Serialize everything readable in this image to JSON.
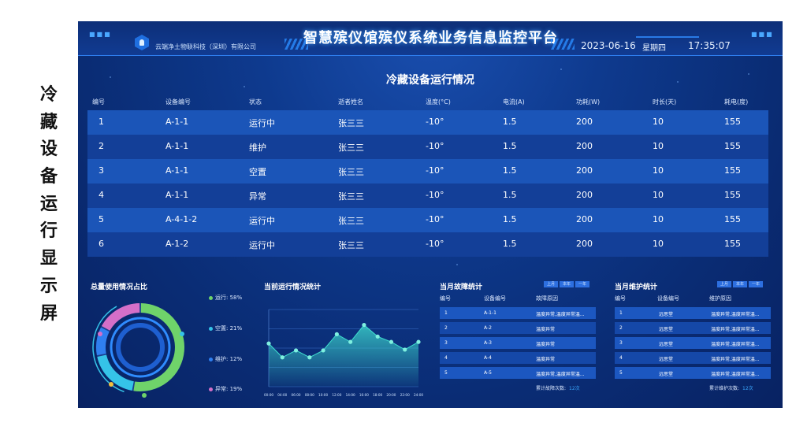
{
  "caption": [
    "冷",
    "藏",
    "设",
    "备",
    "运",
    "行",
    "显",
    "示",
    "屏"
  ],
  "header": {
    "company": "云端净土物联科技（深圳）有限公司",
    "title": "智慧殡仪馆殡仪系统业务信息监控平台",
    "date": "2023-06-16",
    "weekday": "星期四",
    "time": "17:35:07"
  },
  "table": {
    "title": "冷藏设备运行情况",
    "columns": [
      "编号",
      "设备编号",
      "状态",
      "逝者姓名",
      "温度(°C)",
      "电流(A)",
      "功耗(W)",
      "时长(天)",
      "耗电(度)"
    ],
    "rows": [
      [
        "1",
        "A-1-1",
        "运行中",
        "张三三",
        "-10°",
        "1.5",
        "200",
        "10",
        "155"
      ],
      [
        "2",
        "A-1-1",
        "维护",
        "张三三",
        "-10°",
        "1.5",
        "200",
        "10",
        "155"
      ],
      [
        "3",
        "A-1-1",
        "空置",
        "张三三",
        "-10°",
        "1.5",
        "200",
        "10",
        "155"
      ],
      [
        "4",
        "A-1-1",
        "异常",
        "张三三",
        "-10°",
        "1.5",
        "200",
        "10",
        "155"
      ],
      [
        "5",
        "A-4-1-2",
        "运行中",
        "张三三",
        "-10°",
        "1.5",
        "200",
        "10",
        "155"
      ],
      [
        "6",
        "A-1-2",
        "运行中",
        "张三三",
        "-10°",
        "1.5",
        "200",
        "10",
        "155"
      ]
    ]
  },
  "usage": {
    "title": "总量使用情况占比",
    "legend": [
      {
        "label": "运行: 58%",
        "color": "#6fd36a",
        "percent": 58
      },
      {
        "label": "空置: 21%",
        "color": "#35c3e8",
        "percent": 21
      },
      {
        "label": "维护: 12%",
        "color": "#2f7ff0",
        "percent": 12
      },
      {
        "label": "异常: 19%",
        "color": "#d46fc8",
        "percent": 19
      }
    ]
  },
  "running": {
    "title": "当前运行情况统计",
    "chart_data": {
      "type": "area",
      "x": [
        "00:00",
        "04:00",
        "06:00",
        "08:00",
        "10:00",
        "12:00",
        "14:00",
        "16:00",
        "18:00",
        "20:00",
        "22:00",
        "24:00"
      ],
      "series": [
        {
          "values": [
            56,
            38,
            47,
            38,
            47,
            68,
            58,
            80,
            65,
            58,
            48,
            58
          ]
        }
      ],
      "ylim": [
        0,
        100
      ],
      "grid": true,
      "color": "#3fe0d0"
    }
  },
  "faults": {
    "title": "当月故障统计",
    "tabs": [
      "上月",
      "本年",
      "一年"
    ],
    "columns": [
      "编号",
      "设备编号",
      "故障原因"
    ],
    "rows": [
      [
        "1",
        "A-1-1",
        "温度异常,温度异常温..."
      ],
      [
        "2",
        "A-2",
        "温度异常"
      ],
      [
        "3",
        "A-3",
        "温度异常"
      ],
      [
        "4",
        "A-4",
        "温度异常"
      ],
      [
        "5",
        "A-5",
        "温度异常,温度异常温..."
      ]
    ],
    "total_label": "累计故障次数:",
    "total_value": "12次"
  },
  "maintenance": {
    "title": "当月维护统计",
    "tabs": [
      "上月",
      "本年",
      "一年"
    ],
    "columns": [
      "编号",
      "设备编号",
      "维护原因"
    ],
    "rows": [
      [
        "1",
        "远思堂",
        "温度异常,温度异常温..."
      ],
      [
        "2",
        "远思堂",
        "温度异常,温度异常温..."
      ],
      [
        "3",
        "远思堂",
        "温度异常,温度异常温..."
      ],
      [
        "4",
        "远思堂",
        "温度异常,温度异常温..."
      ],
      [
        "5",
        "远思堂",
        "温度异常,温度异常温..."
      ]
    ],
    "total_label": "累计维护次数:",
    "total_value": "12次"
  }
}
